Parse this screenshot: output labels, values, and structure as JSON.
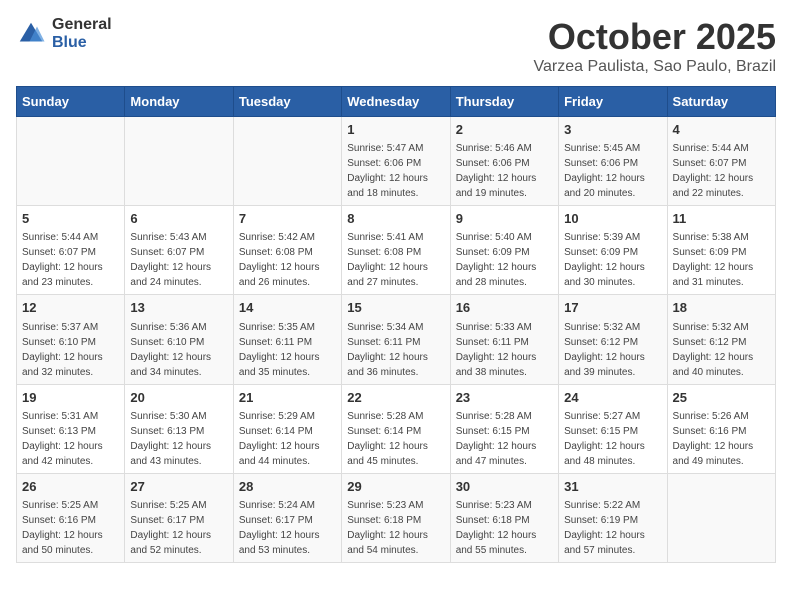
{
  "header": {
    "logo_general": "General",
    "logo_blue": "Blue",
    "month_title": "October 2025",
    "location": "Varzea Paulista, Sao Paulo, Brazil"
  },
  "days_of_week": [
    "Sunday",
    "Monday",
    "Tuesday",
    "Wednesday",
    "Thursday",
    "Friday",
    "Saturday"
  ],
  "weeks": [
    [
      {
        "day": "",
        "info": ""
      },
      {
        "day": "",
        "info": ""
      },
      {
        "day": "",
        "info": ""
      },
      {
        "day": "1",
        "info": "Sunrise: 5:47 AM\nSunset: 6:06 PM\nDaylight: 12 hours\nand 18 minutes."
      },
      {
        "day": "2",
        "info": "Sunrise: 5:46 AM\nSunset: 6:06 PM\nDaylight: 12 hours\nand 19 minutes."
      },
      {
        "day": "3",
        "info": "Sunrise: 5:45 AM\nSunset: 6:06 PM\nDaylight: 12 hours\nand 20 minutes."
      },
      {
        "day": "4",
        "info": "Sunrise: 5:44 AM\nSunset: 6:07 PM\nDaylight: 12 hours\nand 22 minutes."
      }
    ],
    [
      {
        "day": "5",
        "info": "Sunrise: 5:44 AM\nSunset: 6:07 PM\nDaylight: 12 hours\nand 23 minutes."
      },
      {
        "day": "6",
        "info": "Sunrise: 5:43 AM\nSunset: 6:07 PM\nDaylight: 12 hours\nand 24 minutes."
      },
      {
        "day": "7",
        "info": "Sunrise: 5:42 AM\nSunset: 6:08 PM\nDaylight: 12 hours\nand 26 minutes."
      },
      {
        "day": "8",
        "info": "Sunrise: 5:41 AM\nSunset: 6:08 PM\nDaylight: 12 hours\nand 27 minutes."
      },
      {
        "day": "9",
        "info": "Sunrise: 5:40 AM\nSunset: 6:09 PM\nDaylight: 12 hours\nand 28 minutes."
      },
      {
        "day": "10",
        "info": "Sunrise: 5:39 AM\nSunset: 6:09 PM\nDaylight: 12 hours\nand 30 minutes."
      },
      {
        "day": "11",
        "info": "Sunrise: 5:38 AM\nSunset: 6:09 PM\nDaylight: 12 hours\nand 31 minutes."
      }
    ],
    [
      {
        "day": "12",
        "info": "Sunrise: 5:37 AM\nSunset: 6:10 PM\nDaylight: 12 hours\nand 32 minutes."
      },
      {
        "day": "13",
        "info": "Sunrise: 5:36 AM\nSunset: 6:10 PM\nDaylight: 12 hours\nand 34 minutes."
      },
      {
        "day": "14",
        "info": "Sunrise: 5:35 AM\nSunset: 6:11 PM\nDaylight: 12 hours\nand 35 minutes."
      },
      {
        "day": "15",
        "info": "Sunrise: 5:34 AM\nSunset: 6:11 PM\nDaylight: 12 hours\nand 36 minutes."
      },
      {
        "day": "16",
        "info": "Sunrise: 5:33 AM\nSunset: 6:11 PM\nDaylight: 12 hours\nand 38 minutes."
      },
      {
        "day": "17",
        "info": "Sunrise: 5:32 AM\nSunset: 6:12 PM\nDaylight: 12 hours\nand 39 minutes."
      },
      {
        "day": "18",
        "info": "Sunrise: 5:32 AM\nSunset: 6:12 PM\nDaylight: 12 hours\nand 40 minutes."
      }
    ],
    [
      {
        "day": "19",
        "info": "Sunrise: 5:31 AM\nSunset: 6:13 PM\nDaylight: 12 hours\nand 42 minutes."
      },
      {
        "day": "20",
        "info": "Sunrise: 5:30 AM\nSunset: 6:13 PM\nDaylight: 12 hours\nand 43 minutes."
      },
      {
        "day": "21",
        "info": "Sunrise: 5:29 AM\nSunset: 6:14 PM\nDaylight: 12 hours\nand 44 minutes."
      },
      {
        "day": "22",
        "info": "Sunrise: 5:28 AM\nSunset: 6:14 PM\nDaylight: 12 hours\nand 45 minutes."
      },
      {
        "day": "23",
        "info": "Sunrise: 5:28 AM\nSunset: 6:15 PM\nDaylight: 12 hours\nand 47 minutes."
      },
      {
        "day": "24",
        "info": "Sunrise: 5:27 AM\nSunset: 6:15 PM\nDaylight: 12 hours\nand 48 minutes."
      },
      {
        "day": "25",
        "info": "Sunrise: 5:26 AM\nSunset: 6:16 PM\nDaylight: 12 hours\nand 49 minutes."
      }
    ],
    [
      {
        "day": "26",
        "info": "Sunrise: 5:25 AM\nSunset: 6:16 PM\nDaylight: 12 hours\nand 50 minutes."
      },
      {
        "day": "27",
        "info": "Sunrise: 5:25 AM\nSunset: 6:17 PM\nDaylight: 12 hours\nand 52 minutes."
      },
      {
        "day": "28",
        "info": "Sunrise: 5:24 AM\nSunset: 6:17 PM\nDaylight: 12 hours\nand 53 minutes."
      },
      {
        "day": "29",
        "info": "Sunrise: 5:23 AM\nSunset: 6:18 PM\nDaylight: 12 hours\nand 54 minutes."
      },
      {
        "day": "30",
        "info": "Sunrise: 5:23 AM\nSunset: 6:18 PM\nDaylight: 12 hours\nand 55 minutes."
      },
      {
        "day": "31",
        "info": "Sunrise: 5:22 AM\nSunset: 6:19 PM\nDaylight: 12 hours\nand 57 minutes."
      },
      {
        "day": "",
        "info": ""
      }
    ]
  ]
}
